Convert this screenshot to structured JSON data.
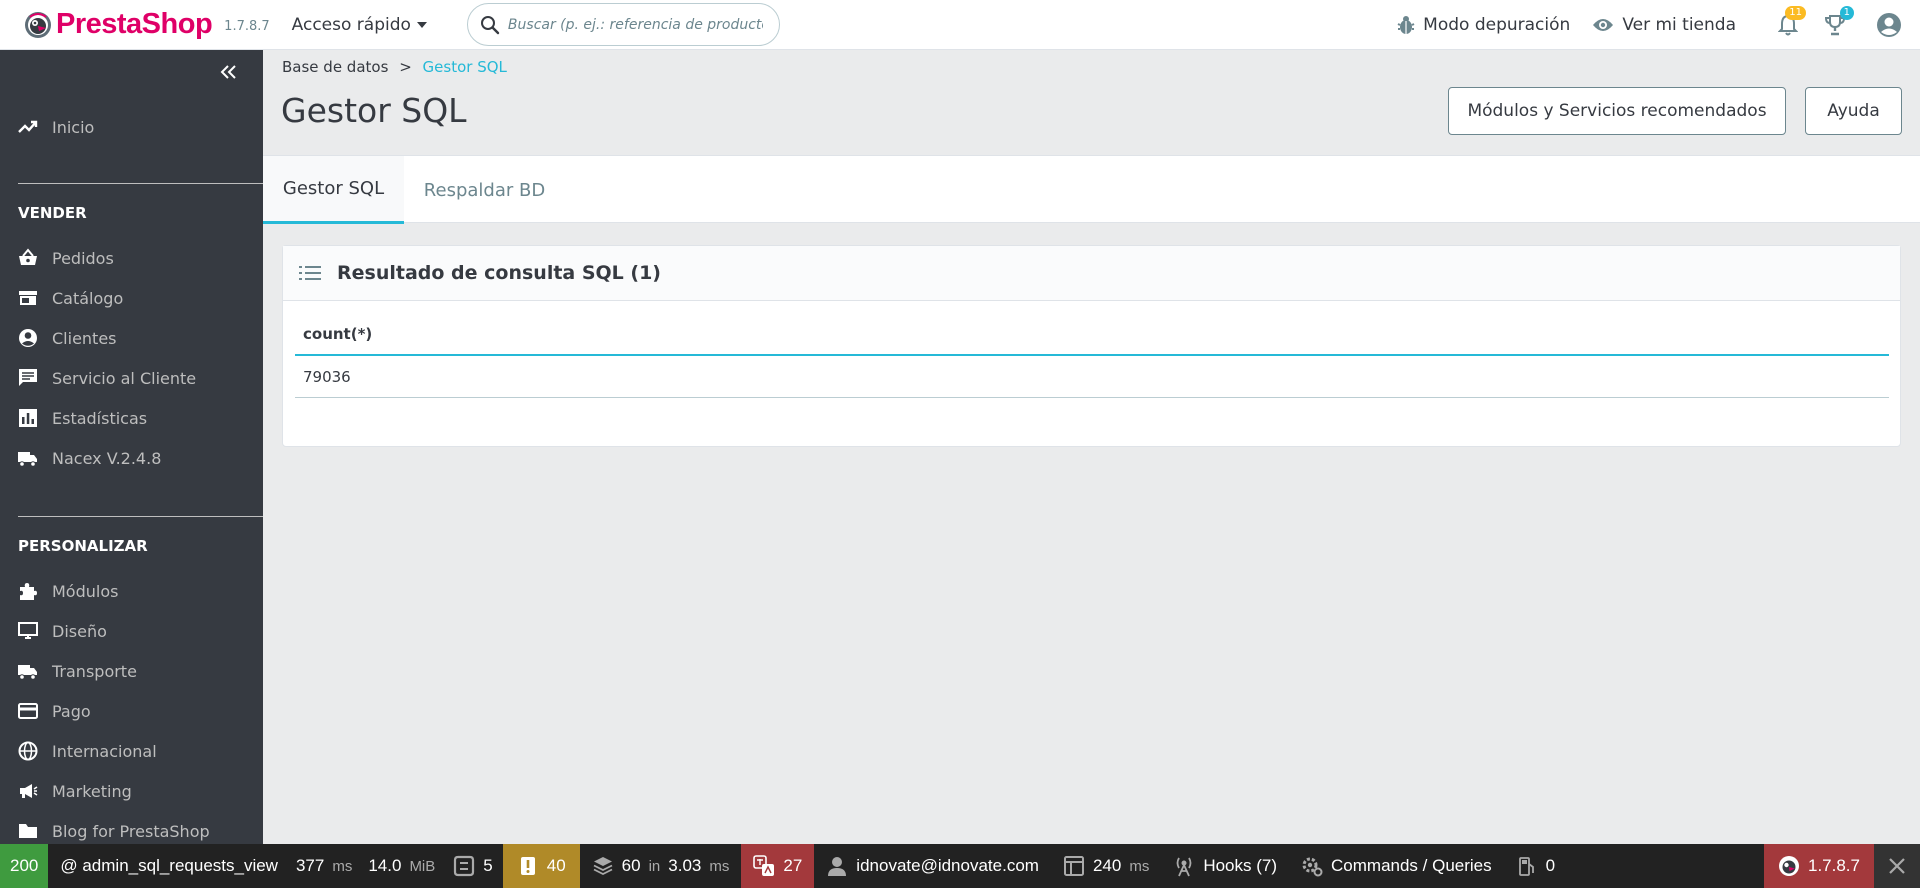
{
  "header": {
    "logo_text": "PrestaShop",
    "version": "1.7.8.7",
    "quick_access": "Acceso rápido",
    "search_placeholder": "Buscar (p. ej.: referencia de producto, .",
    "debug_mode": "Modo depuración",
    "view_store": "Ver mi tienda",
    "notifications_count": "11",
    "trophy_count": "1"
  },
  "sidebar": {
    "home": "Inicio",
    "section_sell": "VENDER",
    "sell_items": [
      "Pedidos",
      "Catálogo",
      "Clientes",
      "Servicio al Cliente",
      "Estadísticas",
      "Nacex V.2.4.8"
    ],
    "section_customize": "PERSONALIZAR",
    "customize_items": [
      "Módulos",
      "Diseño",
      "Transporte",
      "Pago",
      "Internacional",
      "Marketing",
      "Blog for PrestaShop"
    ]
  },
  "breadcrumb": {
    "parent": "Base de datos",
    "separator": ">",
    "current": "Gestor SQL"
  },
  "page_title": "Gestor SQL",
  "toolbar": {
    "modules_button": "Módulos y Servicios recomendados",
    "help_button": "Ayuda"
  },
  "tabs": [
    {
      "label": "Gestor SQL",
      "active": true
    },
    {
      "label": "Respaldar BD",
      "active": false
    }
  ],
  "panel": {
    "title": "Resultado de consulta SQL (1)",
    "columns": [
      "count(*)"
    ],
    "rows": [
      [
        "79036"
      ]
    ]
  },
  "debugbar": {
    "status": "200",
    "route": "@ admin_sql_requests_view",
    "time_value": "377",
    "time_unit": "ms",
    "memory_value": "14.0",
    "memory_unit": "MiB",
    "forms_count": "5",
    "logs_count": "40",
    "queries_count": "60",
    "queries_in": "in",
    "queries_time": "3.03",
    "queries_unit": "ms",
    "translations_count": "27",
    "user": "idnovate@idnovate.com",
    "render_time": "240",
    "render_unit": "ms",
    "hooks": "Hooks (7)",
    "commands": "Commands / Queries",
    "symfony_count": "0",
    "ps_version": "1.7.8.7",
    "colors": {
      "status": "#3f9b3f",
      "logs": "#b08a28",
      "translations": "#a3393c",
      "version": "#a3393c"
    }
  }
}
